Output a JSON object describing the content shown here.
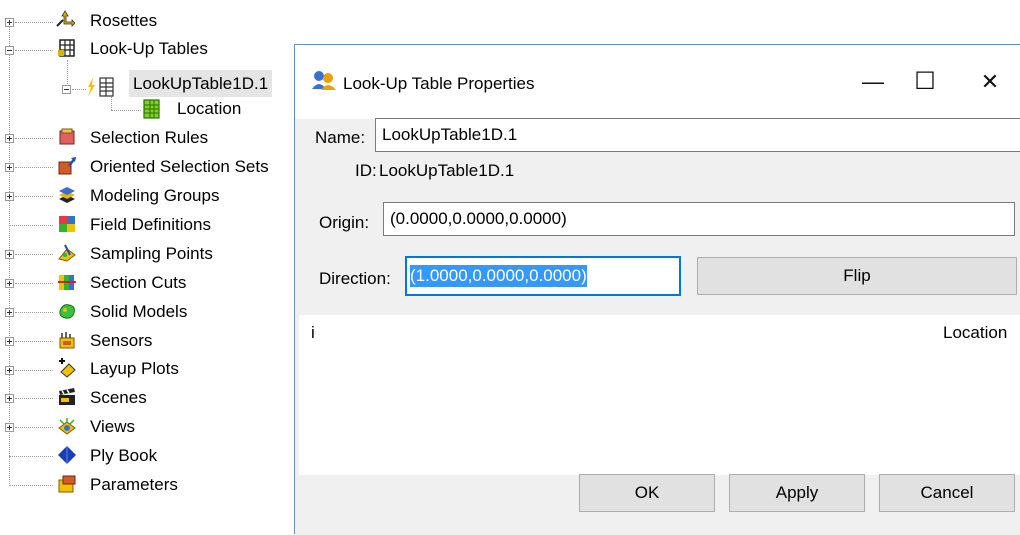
{
  "tree": {
    "items": [
      {
        "label": "Rosettes",
        "icon": "rosettes-icon"
      },
      {
        "label": "Look-Up Tables",
        "icon": "lookup-tables-icon"
      },
      {
        "label": "LookUpTable1D.1",
        "icon": "lookup-table-icon"
      },
      {
        "label": "Location",
        "icon": "location-table-icon"
      },
      {
        "label": "Selection Rules",
        "icon": "selection-rules-icon"
      },
      {
        "label": "Oriented Selection Sets",
        "icon": "oriented-selection-sets-icon"
      },
      {
        "label": "Modeling Groups",
        "icon": "modeling-groups-icon"
      },
      {
        "label": "Field Definitions",
        "icon": "field-definitions-icon"
      },
      {
        "label": "Sampling Points",
        "icon": "sampling-points-icon"
      },
      {
        "label": "Section Cuts",
        "icon": "section-cuts-icon"
      },
      {
        "label": "Solid Models",
        "icon": "solid-models-icon"
      },
      {
        "label": "Sensors",
        "icon": "sensors-icon"
      },
      {
        "label": "Layup Plots",
        "icon": "layup-plots-icon"
      },
      {
        "label": "Scenes",
        "icon": "scenes-icon"
      },
      {
        "label": "Views",
        "icon": "views-icon"
      },
      {
        "label": "Ply Book",
        "icon": "ply-book-icon"
      },
      {
        "label": "Parameters",
        "icon": "parameters-icon"
      }
    ]
  },
  "dialog": {
    "title": "Look-Up Table Properties",
    "name_label": "Name:",
    "name_value": "LookUpTable1D.1",
    "id_label": "ID:",
    "id_value": "LookUpTable1D.1",
    "origin_label": "Origin:",
    "origin_value": "(0.0000,0.0000,0.0000)",
    "direction_label": "Direction:",
    "direction_value": "(1.0000,0.0000,0.0000)",
    "flip_label": "Flip",
    "table_columns": [
      "i",
      "Location"
    ],
    "ok_label": "OK",
    "apply_label": "Apply",
    "cancel_label": "Cancel",
    "minimize_glyph": "—",
    "maximize_glyph": "☐",
    "close_glyph": "✕"
  }
}
